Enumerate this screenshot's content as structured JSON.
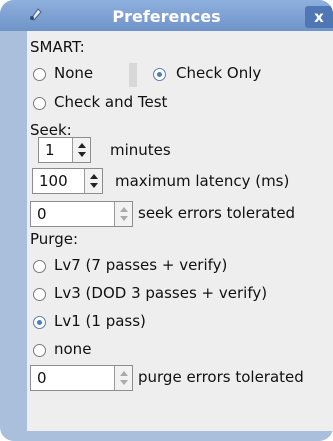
{
  "window": {
    "title": "Preferences",
    "close_label": "x",
    "accent": "#6f94c8"
  },
  "smart": {
    "heading": "SMART:",
    "options": [
      "None",
      "Check Only",
      "Check and Test"
    ],
    "selected": "Check Only"
  },
  "seek": {
    "heading": "Seek:",
    "minutes_value": "1",
    "minutes_label": "minutes",
    "latency_value": "100",
    "latency_label": "maximum latency (ms)",
    "errors_value": "0",
    "errors_label": "seek errors tolerated"
  },
  "purge": {
    "heading": "Purge:",
    "options": [
      "Lv7 (7 passes + verify)",
      "Lv3 (DOD 3 passes + verify)",
      "Lv1 (1 pass)",
      "none"
    ],
    "selected": "Lv1 (1 pass)",
    "errors_value": "0",
    "errors_label": "purge errors tolerated"
  },
  "icons": {
    "title_icon": "app-icon",
    "close": "close-icon"
  }
}
